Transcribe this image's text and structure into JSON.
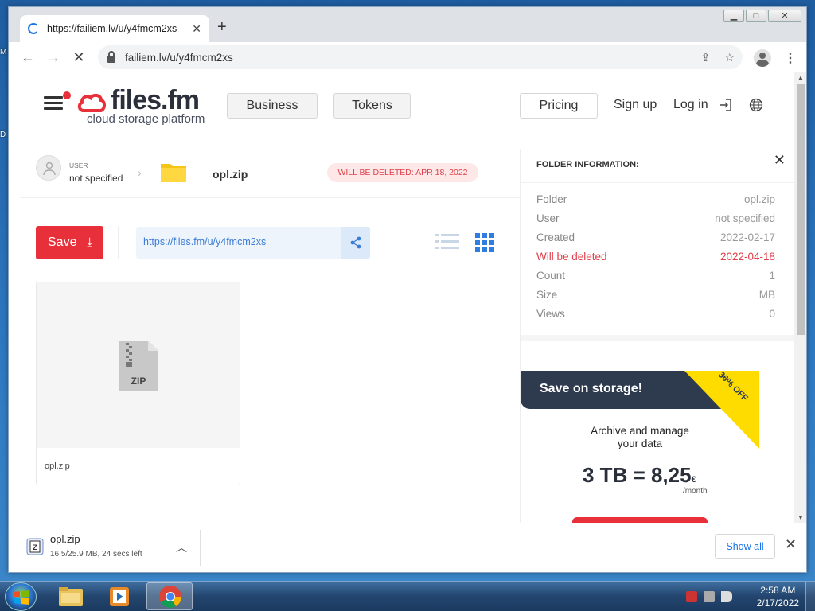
{
  "desktop": {
    "edge_texts": [
      "M",
      "D"
    ]
  },
  "browser": {
    "tab": {
      "title": "https://failiem.lv/u/y4fmcm2xs",
      "close": "✕"
    },
    "new_tab": "+",
    "url": "failiem.lv/u/y4fmcm2xs",
    "window_controls": {
      "minimize": "▁",
      "maximize": "□",
      "close": "✕"
    }
  },
  "site": {
    "logo": {
      "name": "files.fm",
      "tagline": "cloud storage platform"
    },
    "nav": {
      "business": "Business",
      "tokens": "Tokens",
      "pricing": "Pricing",
      "signup": "Sign up",
      "login": "Log in"
    },
    "user": {
      "label": "USER",
      "value": "not specified"
    },
    "folder_name": "opl.zip",
    "delete_badge": "WILL BE DELETED: APR 18, 2022",
    "save_label": "Save",
    "share_url": "https://files.fm/u/y4fmcm2xs",
    "file": {
      "caption": "opl.zip",
      "icon_text": "ZIP"
    }
  },
  "panel": {
    "title": "FOLDER INFORMATION:",
    "close": "✕",
    "rows": [
      {
        "label": "Folder",
        "value": "opl.zip"
      },
      {
        "label": "User",
        "value": "not specified"
      },
      {
        "label": "Created",
        "value": "2022-02-17"
      },
      {
        "label": "Will be deleted",
        "value": "2022-04-18"
      },
      {
        "label": "Count",
        "value": "1"
      },
      {
        "label": "Size",
        "value": "MB"
      },
      {
        "label": "Views",
        "value": "0"
      }
    ],
    "promo": {
      "title": "Save on storage!",
      "discount": "36% OFF",
      "line1": "Archive and manage",
      "line2": "your data",
      "price": "3 TB = 8,25",
      "currency": "€",
      "per": "/month"
    }
  },
  "downloads": {
    "filename": "opl.zip",
    "status": "16.5/25.9 MB, 24 secs left",
    "show_all": "Show all"
  },
  "taskbar": {
    "time": "2:58 AM",
    "date": "2/17/2022"
  },
  "colors": {
    "brand_red": "#e8303a",
    "link_blue": "#3a7bd5",
    "promo_navy": "#2e3a4e",
    "promo_yellow": "#ffdc00"
  }
}
